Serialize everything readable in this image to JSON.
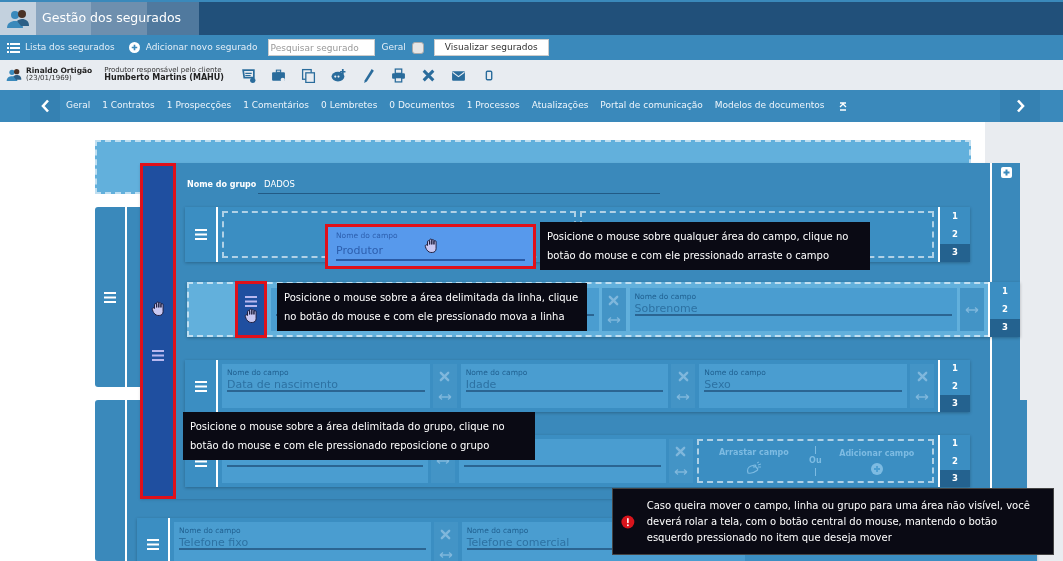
{
  "app": {
    "title": "Gestão dos segurados"
  },
  "toolbar": {
    "links": [
      "Lista dos segurados",
      "Adicionar novo segurado"
    ],
    "search": {
      "placeholder": "Pesquisar segurado"
    },
    "filter": {
      "label": "Geral",
      "checked": false
    },
    "button": "Visualizar segurados"
  },
  "client": {
    "name": "Rinaldo Ortigão",
    "birth": "(23/01/1969)",
    "producer_caption": "Produtor responsável pelo cliente",
    "producer": "Humberto Martins (MAHU)"
  },
  "tabs": [
    "Geral",
    "1 Contratos",
    "1 Prospecções",
    "1 Comentários",
    "0 Lembretes",
    "0 Documentos",
    "1 Processos",
    "Atualizações",
    "Portal de comunicação",
    "Modelos de documentos"
  ],
  "group": {
    "label": "Nome do grupo",
    "value": "DADOS",
    "dragging": true
  },
  "rows": [
    {
      "dragging": false,
      "fields": [
        {
          "kind": "dropzone"
        },
        {
          "kind": "dropzone"
        }
      ],
      "columns": [
        {
          "label": "1",
          "selected": false
        },
        {
          "label": "2",
          "selected": false
        },
        {
          "label": "3",
          "selected": true
        }
      ]
    },
    {
      "dragging": true,
      "fields": [
        {
          "kind": "field",
          "removable": true
        },
        {
          "kind": "field",
          "label": "Nome do campo",
          "value": "Sobrenome",
          "removable": false
        }
      ],
      "columns": [
        {
          "label": "1",
          "selected": false
        },
        {
          "label": "2",
          "selected": false
        },
        {
          "label": "3",
          "selected": true
        }
      ]
    },
    {
      "dragging": false,
      "fields": [
        {
          "kind": "field",
          "label": "Nome do campo",
          "value": "Data de nascimento",
          "removable": true
        },
        {
          "kind": "field",
          "label": "Nome do campo",
          "value": "Idade",
          "removable": true
        },
        {
          "kind": "field",
          "label": "Nome do campo",
          "value": "Sexo",
          "removable": true
        }
      ],
      "columns": [
        {
          "label": "1",
          "selected": false
        },
        {
          "label": "2",
          "selected": false
        },
        {
          "label": "3",
          "selected": true
        }
      ]
    },
    {
      "dragging": false,
      "fields": [
        {
          "kind": "field"
        },
        {
          "kind": "field",
          "removable": true
        },
        {
          "kind": "dropzone",
          "drag": "Arrastar campo",
          "or": "Ou",
          "add": "Adicionar campo"
        }
      ],
      "columns": [
        {
          "label": "1",
          "selected": false
        },
        {
          "label": "2",
          "selected": false
        },
        {
          "label": "3",
          "selected": true
        }
      ]
    },
    {
      "dragging": false,
      "fields": [
        {
          "kind": "field",
          "label": "Nome do campo",
          "value": "Telefone fixo",
          "removable": true
        },
        {
          "kind": "field",
          "label": "Nome do campo",
          "value": "Telefone comercial"
        }
      ]
    }
  ],
  "dragged_field": {
    "label": "Nome do campo",
    "value": "Produtor"
  },
  "tooltips": [
    "Posicione o mouse sobre qualquer área do campo, clique no botão do mouse e com ele pressionado arraste o campo",
    "Posicione o mouse sobre a área delimitada da linha, clique no botão do mouse e com ele pressionado mova a linha",
    "Posicione o mouse sobre a área delimitada do grupo, clique no botão do mouse e com ele pressionado reposicione o grupo"
  ],
  "alert": {
    "text": "Caso queira mover o campo, linha ou grupo para uma área não visível, você deverá rolar a tela, com o botão central do mouse, mantendo o botão esquerdo pressionado no item que deseja mover"
  }
}
